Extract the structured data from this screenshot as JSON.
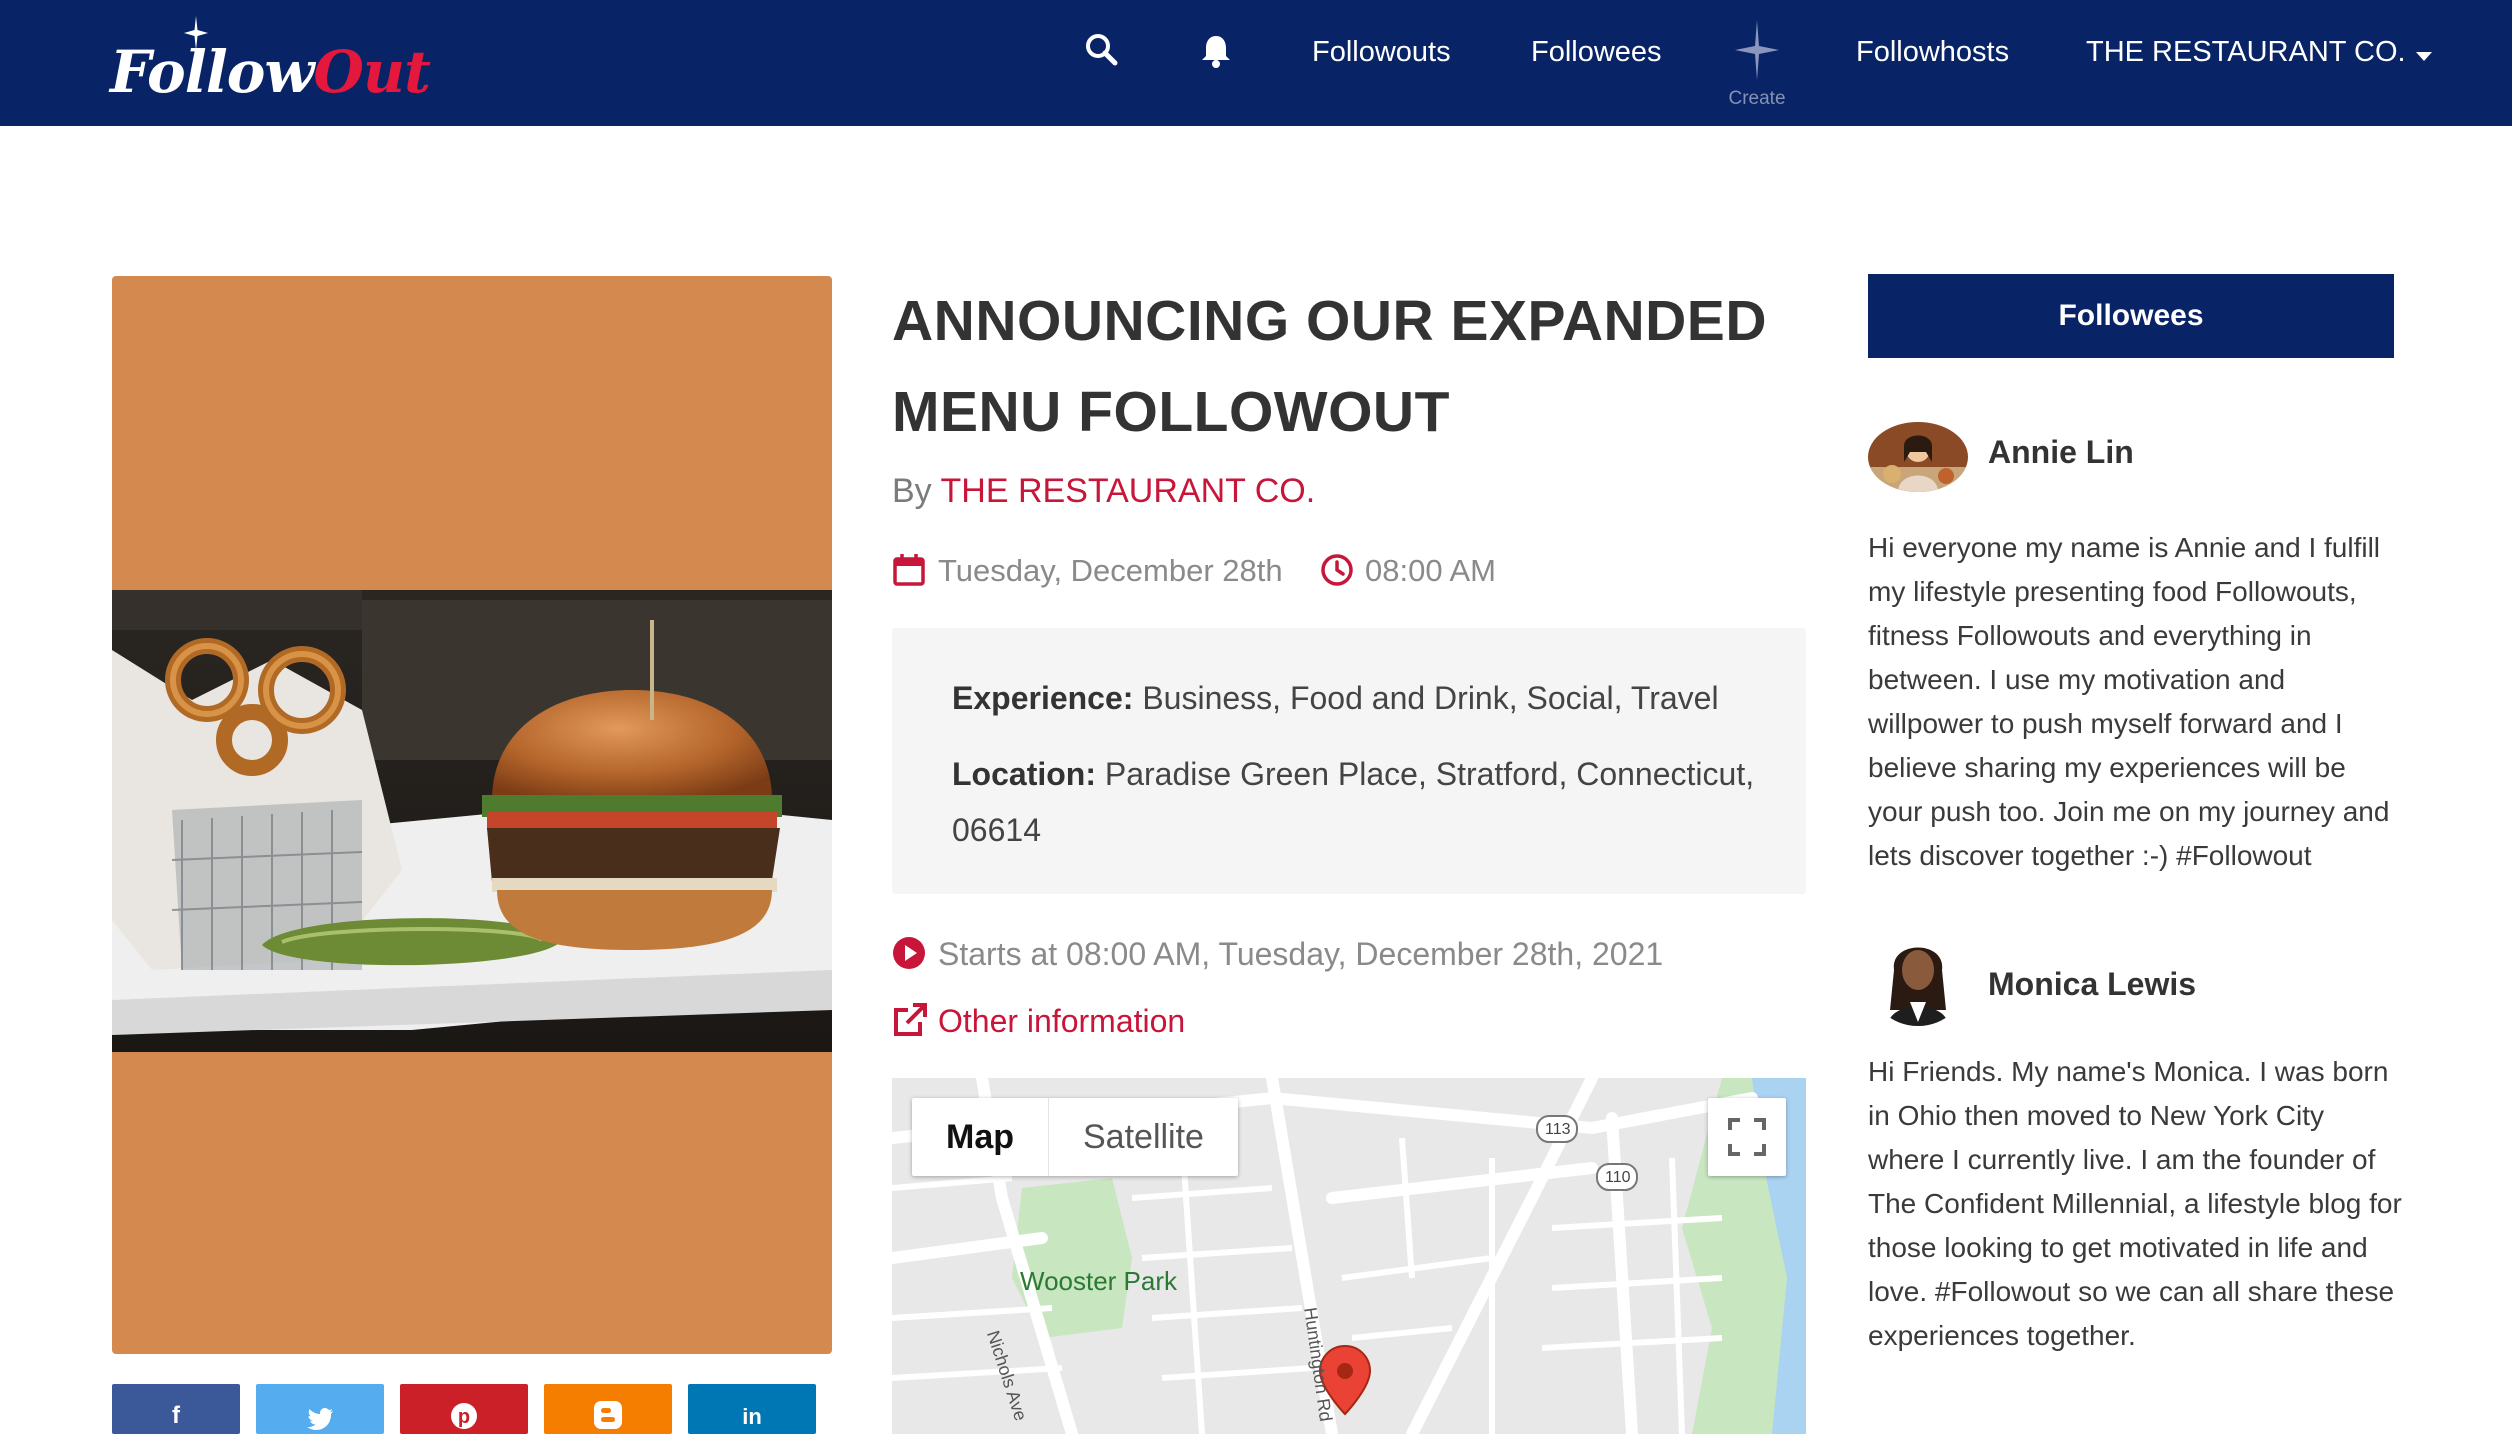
{
  "brand": {
    "logo_white": "Follow",
    "logo_red": "Out"
  },
  "nav": {
    "links": [
      "Followouts",
      "Followees",
      "Followhosts"
    ],
    "create_label": "Create",
    "account_label": "THE RESTAURANT CO.",
    "icons": [
      "search-icon",
      "bell-icon",
      "sparkle-icon",
      "caret-down-icon"
    ]
  },
  "event": {
    "title": "ANNOUNCING OUR EXPANDED MENU FOLLOWOUT",
    "by_prefix": "By",
    "host": "THE RESTAURANT CO.",
    "date": "Tuesday, December 28th",
    "time": "08:00 AM",
    "experience_label": "Experience:",
    "experience_value": "Business, Food and Drink, Social, Travel",
    "location_label": "Location:",
    "location_value": "Paradise Green Place, Stratford, Connecticut, 06614",
    "starts_text": "Starts at 08:00 AM, Tuesday, December 28th, 2021",
    "other_info": "Other information"
  },
  "share": {
    "buttons": [
      {
        "icon": "facebook-icon",
        "glyph": "f",
        "color": "#3b5998"
      },
      {
        "icon": "twitter-icon",
        "glyph": "🐦",
        "color": "#55acee"
      },
      {
        "icon": "pinterest-icon",
        "glyph": "p",
        "color": "#cb2027"
      },
      {
        "icon": "blogger-icon",
        "glyph": "B",
        "color": "#f57d00"
      },
      {
        "icon": "linkedin-icon",
        "glyph": "in",
        "color": "#0077b5"
      }
    ]
  },
  "map": {
    "tab_map": "Map",
    "tab_satellite": "Satellite",
    "park_label": "Wooster Park",
    "street_1": "Nichols Ave",
    "street_2": "Huntington Rd",
    "route_1": "113",
    "route_2": "110"
  },
  "sidebar": {
    "header": "Followees",
    "followees": [
      {
        "name": "Annie Lin",
        "bio": "Hi everyone my name is Annie and I fulfill my lifestyle presenting food Followouts, fitness Followouts and everything in between. I use my motivation and willpower to push myself forward and I believe sharing my experiences will be your push too. Join me on my journey and lets discover together :-) #Followout"
      },
      {
        "name": "Monica Lewis",
        "bio": "Hi Friends. My name's Monica. I was born in Ohio then moved to New York City where I currently live. I am the founder of The Confident Millennial, a lifestyle blog for those looking to get motivated in life and love. #Followout so we can all share these experiences together."
      }
    ]
  },
  "colors": {
    "navy": "#092466",
    "accent_red": "#c7163a",
    "image_bg": "#d4894e"
  }
}
